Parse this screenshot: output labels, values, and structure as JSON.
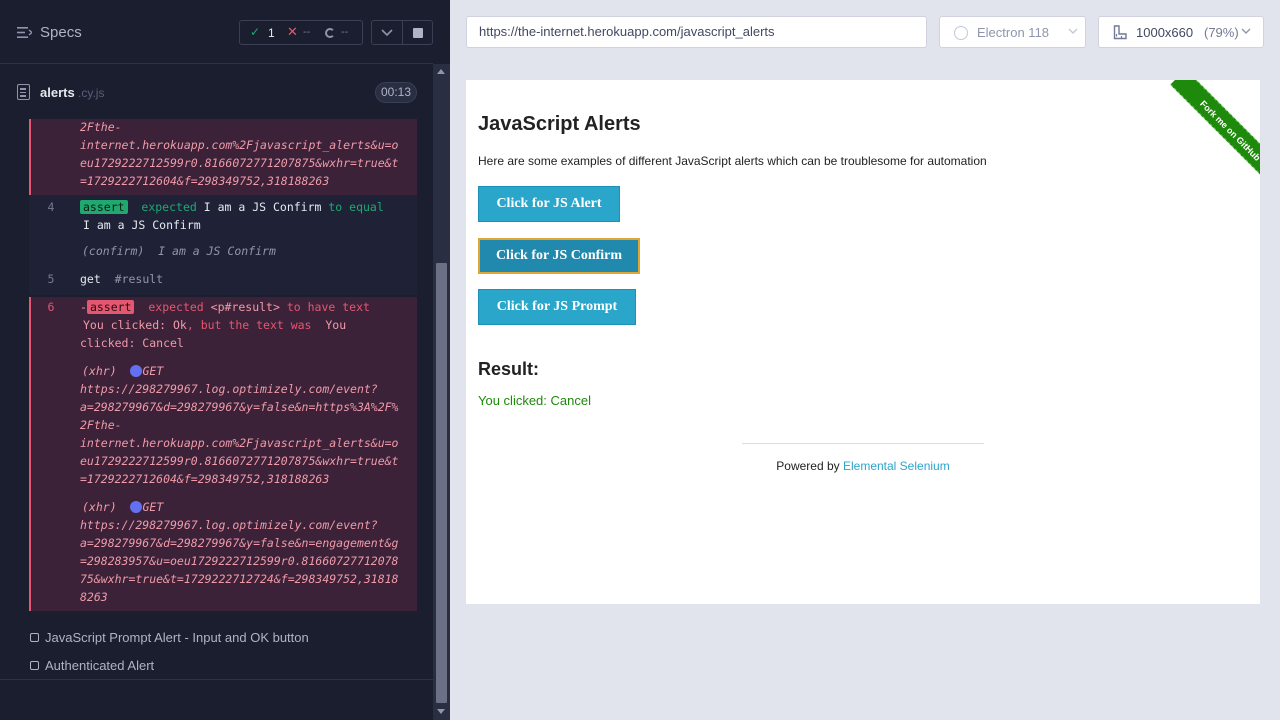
{
  "runner": {
    "specs_title": "Specs",
    "stats": {
      "passed": "1",
      "failed": "--",
      "pending": "--"
    },
    "file": {
      "name": "alerts",
      "ext": ".cy.js",
      "timer": "00:13"
    },
    "log": {
      "block1_lines": [
        "2Fthe-",
        "internet.herokuapp.com%2Fjavascript_alerts&u=o",
        "eu1729222712599r0.8166072771207875&wxhr=true&t",
        "=1729222712604&f=298349752,318188263"
      ],
      "step4": {
        "num": "4",
        "badge": "assert",
        "expected_word": "expected",
        "expected_value": "I am a JS Confirm",
        "to_equal": "to equal",
        "equal_value": "I am a JS Confirm",
        "confirm_tag": "(confirm)",
        "confirm_text": "I am a JS Confirm"
      },
      "step5": {
        "num": "5",
        "cmd": "get",
        "arg": "#result"
      },
      "step6": {
        "num": "6",
        "dash": "-",
        "badge": "assert",
        "expected_word": "expected",
        "subject": "<p#result>",
        "to_have_text": "to have text",
        "expected_text": "You clicked: Ok",
        "but_text": ", but the text was",
        "actual_text_1": "You",
        "actual_text_2": "clicked: Cancel",
        "xhr1_tag": "(xhr)",
        "xhr1_method": "GET",
        "xhr1_lines": [
          "https://298279967.log.optimizely.com/event?",
          "a=298279967&d=298279967&y=false&n=https%3A%2F%",
          "2Fthe-",
          "internet.herokuapp.com%2Fjavascript_alerts&u=o",
          "eu1729222712599r0.8166072771207875&wxhr=true&t",
          "=1729222712604&f=298349752,318188263"
        ],
        "xhr2_tag": "(xhr)",
        "xhr2_method": "GET",
        "xhr2_lines": [
          "https://298279967.log.optimizely.com/event?",
          "a=298279967&d=298279967&y=false&n=engagement&g",
          "=298283957&u=oeu1729222712599r0.81660727712078",
          "75&wxhr=true&t=1729222712724&f=298349752,31818",
          "8263"
        ]
      }
    },
    "tests": [
      {
        "label": "JavaScript Prompt Alert - Input and OK button"
      },
      {
        "label": "Authenticated Alert"
      }
    ]
  },
  "toolbar": {
    "url": "https://the-internet.herokuapp.com/javascript_alerts",
    "browser": "Electron 118",
    "viewport_size": "1000x660",
    "viewport_zoom": "(79%)"
  },
  "aut": {
    "ribbon": "Fork me on GitHub",
    "title": "JavaScript Alerts",
    "description": "Here are some examples of different JavaScript alerts which can be troublesome for automation",
    "buttons": [
      {
        "label": "Click for JS Alert"
      },
      {
        "label": "Click for JS Confirm"
      },
      {
        "label": "Click for JS Prompt"
      }
    ],
    "result_title": "Result:",
    "result_text": "You clicked: Cancel",
    "footer_prefix": "Powered by",
    "footer_link": "Elemental Selenium"
  },
  "colors": {
    "runner_bg": "#1b1e2e",
    "pass_green": "#1fa971",
    "fail_red": "#e45770",
    "aut_button": "#2ba6cb",
    "ribbon_green": "#1e8a0b"
  },
  "icons": {
    "specs": "hamburger-icon",
    "pass": "check-icon",
    "fail": "x-icon",
    "pending": "spinner-icon",
    "file": "document-icon",
    "browser": "electron-icon",
    "viewport": "ruler-icon"
  }
}
